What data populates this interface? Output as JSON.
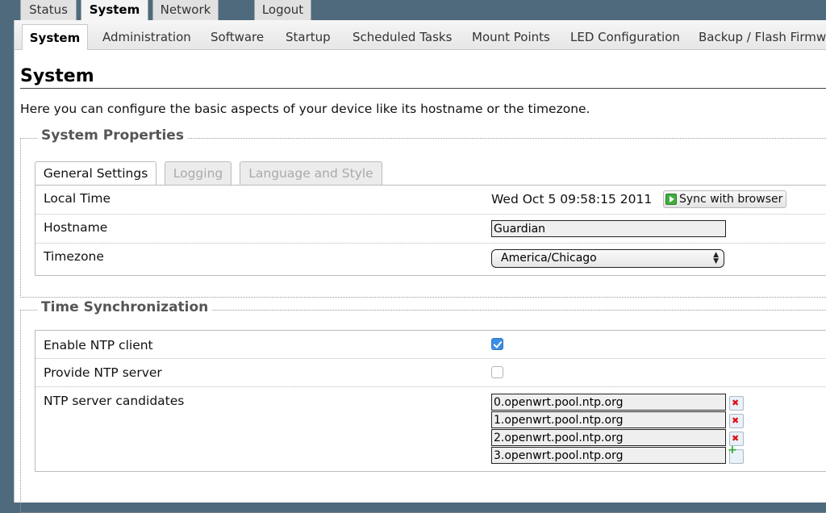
{
  "top_tabs": [
    {
      "label": "Status",
      "active": false
    },
    {
      "label": "System",
      "active": true
    },
    {
      "label": "Network",
      "active": false
    },
    {
      "label": "Logout",
      "active": false
    }
  ],
  "sub_tabs": [
    {
      "label": "System",
      "active": true
    },
    {
      "label": "Administration"
    },
    {
      "label": "Software"
    },
    {
      "label": "Startup"
    },
    {
      "label": "Scheduled Tasks"
    },
    {
      "label": "Mount Points"
    },
    {
      "label": "LED Configuration"
    },
    {
      "label": "Backup / Flash Firmware"
    }
  ],
  "page": {
    "title": "System",
    "description": "Here you can configure the basic aspects of your device like its hostname or the timezone."
  },
  "system_properties": {
    "legend": "System Properties",
    "tabs": [
      {
        "label": "General Settings",
        "active": true
      },
      {
        "label": "Logging",
        "active": false
      },
      {
        "label": "Language and Style",
        "active": false
      }
    ],
    "local_time_label": "Local Time",
    "local_time_value": "Wed Oct 5 09:58:15 2011",
    "sync_button": "Sync with browser",
    "hostname_label": "Hostname",
    "hostname_value": "Guardian",
    "timezone_label": "Timezone",
    "timezone_value": "America/Chicago"
  },
  "time_sync": {
    "legend": "Time Synchronization",
    "enable_ntp_label": "Enable NTP client",
    "enable_ntp_checked": true,
    "provide_ntp_label": "Provide NTP server",
    "provide_ntp_checked": false,
    "ntp_candidates_label": "NTP server candidates",
    "servers": [
      "0.openwrt.pool.ntp.org",
      "1.openwrt.pool.ntp.org",
      "2.openwrt.pool.ntp.org",
      "3.openwrt.pool.ntp.org"
    ]
  },
  "icons": {
    "sync": "play-icon",
    "remove": "remove-icon",
    "add": "add-icon",
    "select_arrows": "select-arrows-icon"
  },
  "colors": {
    "frame": "#4f6a7c",
    "checkbox_on": "#3b8ee5"
  }
}
